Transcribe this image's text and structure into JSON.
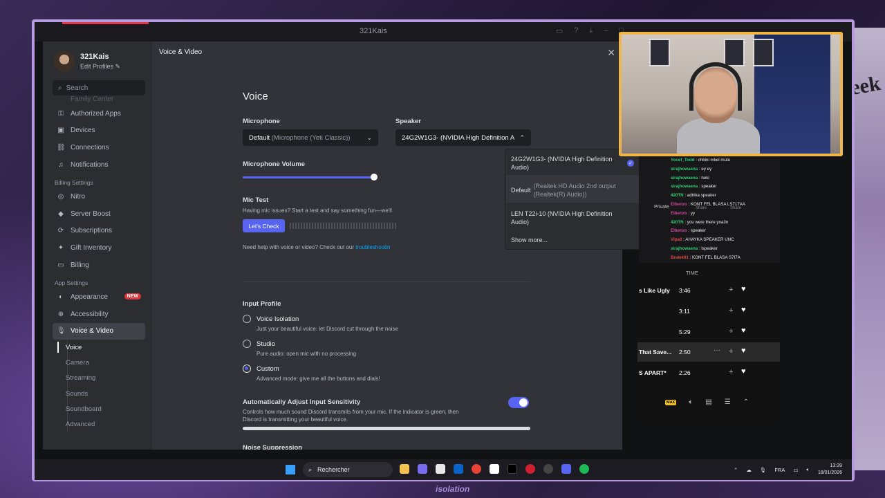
{
  "window": {
    "title": "321Kais"
  },
  "profile": {
    "name": "321Kais",
    "edit_label": "Edit Profiles"
  },
  "search": {
    "placeholder": "Search"
  },
  "sidebar": {
    "faded_item": "Family Center",
    "user_items": [
      {
        "label": "Authorized Apps",
        "icon": "key-icon"
      },
      {
        "label": "Devices",
        "icon": "devices-icon"
      },
      {
        "label": "Connections",
        "icon": "link-icon"
      },
      {
        "label": "Notifications",
        "icon": "bell-icon"
      }
    ],
    "billing_header": "Billing Settings",
    "billing_items": [
      {
        "label": "Nitro",
        "icon": "nitro-icon"
      },
      {
        "label": "Server Boost",
        "icon": "boost-icon"
      },
      {
        "label": "Subscriptions",
        "icon": "subscriptions-icon"
      },
      {
        "label": "Gift Inventory",
        "icon": "gift-icon"
      },
      {
        "label": "Billing",
        "icon": "card-icon"
      }
    ],
    "app_header": "App Settings",
    "app_items": [
      {
        "label": "Appearance",
        "icon": "palette-icon",
        "badge": "NEW"
      },
      {
        "label": "Accessibility",
        "icon": "accessibility-icon"
      },
      {
        "label": "Voice & Video",
        "icon": "mic-icon"
      }
    ],
    "sub_items": [
      "Voice",
      "Camera",
      "Streaming",
      "Sounds",
      "Soundboard",
      "Advanced"
    ]
  },
  "content": {
    "breadcrumb": "Voice & Video",
    "heading": "Voice",
    "microphone_label": "Microphone",
    "microphone_value": "Default",
    "microphone_detail": "(Microphone (Yeti Classic))",
    "speaker_label": "Speaker",
    "speaker_value": "24G2W1G3- (NVIDIA High Definition A",
    "volume_label": "Microphone Volume",
    "volume_value": 0.98,
    "mic_test_label": "Mic Test",
    "mic_test_desc": "Having mic issues? Start a test and say something fun—we'll",
    "check_button": "Let's Check",
    "help_text": "Need help with voice or video? Check out our",
    "help_link": "troubleshootin",
    "input_profile_label": "Input Profile",
    "profiles": [
      {
        "name": "Voice Isolation",
        "desc": "Just your beautiful voice: let Discord cut through the noise",
        "selected": false
      },
      {
        "name": "Studio",
        "desc": "Pure audio: open mic with no processing",
        "selected": false
      },
      {
        "name": "Custom",
        "desc": "Advanced mode: give me all the buttons and dials!",
        "selected": true
      }
    ],
    "auto_sensitivity_label": "Automatically Adjust Input Sensitivity",
    "auto_sensitivity_desc1": "Controls how much sound Discord transmits from your mic. If the indicator is green, then",
    "auto_sensitivity_desc2": "Discord is transmitting your beautiful voice.",
    "auto_sensitivity_on": true,
    "noise_label": "Noise Suppression"
  },
  "speaker_dropdown": {
    "options": [
      {
        "line1": "24G2W1G3- (NVIDIA High Definition",
        "line2": "Audio)",
        "selected": true
      },
      {
        "main": "Default",
        "detail1": "(Realtek HD Audio 2nd output",
        "detail2": "(Realtek(R) Audio))"
      },
      {
        "line1": "LEN T22i-10 (NVIDIA High Definition",
        "line2": "Audio)"
      }
    ],
    "show_more": "Show more..."
  },
  "chat": [
    {
      "user": "Yocef_Todd",
      "msg": ": chbini mkel mute",
      "color": "green"
    },
    {
      "user": "sirajhowaena",
      "msg": ": ey ey",
      "color": "green"
    },
    {
      "user": "sirajhowaena",
      "msg": ": heki",
      "color": "green"
    },
    {
      "user": "sirajhowaena",
      "msg": ": speaker",
      "color": "green"
    },
    {
      "user": "420TN",
      "msg": ": adhika speaker",
      "color": "green"
    },
    {
      "user": "Elbenzo",
      "msg": ": KONT FEL BLASA LS717AA",
      "color": "pink"
    },
    {
      "user": "Elbenzo",
      "msg": ": yy",
      "color": "pink"
    },
    {
      "user": "420TN",
      "msg": ": you were there yna3n",
      "color": "green"
    },
    {
      "user": "Elbenzo",
      "msg": ": speaker",
      "color": "pink"
    },
    {
      "user": "Vipa0",
      "msg": ": AHAYKA SPEAKER UNC",
      "color": "red"
    },
    {
      "user": "sirajhowaena",
      "msg": ": lspeaker",
      "color": "green"
    },
    {
      "user": "Bralek01",
      "msg": ": KONT FEL BLASA S7I7A",
      "color": "red"
    }
  ],
  "chat_overlay": {
    "private": "Private",
    "share1": "Share",
    "share2": "Share"
  },
  "spotify": {
    "time_header": "TIME",
    "tracks": [
      {
        "title": "s Like Ugly",
        "time": "3:46"
      },
      {
        "title": "",
        "time": "3:11"
      },
      {
        "title": "",
        "time": "5:29"
      },
      {
        "title": "That Save...",
        "time": "2:50",
        "highlight": true
      },
      {
        "title": "S APART*",
        "time": "2:26"
      }
    ],
    "max_badge": "MAX"
  },
  "taskbar": {
    "search_label": "Rechercher",
    "lang": "FRA",
    "time": "13:39",
    "date": "18/01/2026"
  },
  "overlay_text": "isolation",
  "background_poster_text": "Week"
}
